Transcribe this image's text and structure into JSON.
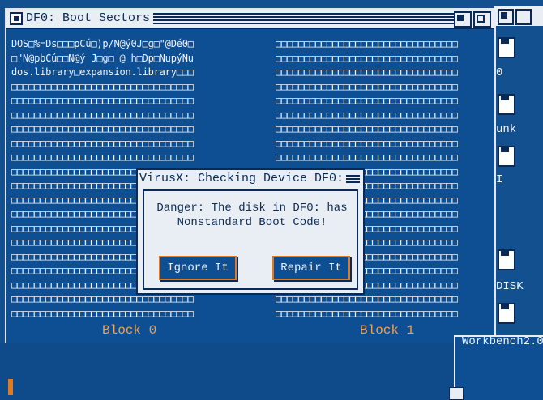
{
  "window": {
    "title": "DF0: Boot Sectors",
    "left_column_lines": [
      "DOS□%=Ds□□□pCú□)p/N@ý0J□g□\"@Dé0□",
      "□\"N@pbCú□□N@ý J□g□ @ h□Dp□NupýNu",
      "dos.library□expansion.library□□□",
      "□□□□□□□□□□□□□□□□□□□□□□□□□□□□□□□□",
      "□□□□□□□□□□□□□□□□□□□□□□□□□□□□□□□□",
      "□□□□□□□□□□□□□□□□□□□□□□□□□□□□□□□□",
      "□□□□□□□□□□□□□□□□□□□□□□□□□□□□□□□□",
      "□□□□□□□□□□□□□□□□□□□□□□□□□□□□□□□□",
      "□□□□□□□□□□□□□□□□□□□□□□□□□□□□□□□□",
      "□□□□□□□□□□□□□□□□□□□□□□□□□□□□□□□□",
      "□□□□□□□□□□□□□□□□□□□□□□□□□□□□□□□□",
      "□□□□□□□□□□□□□□□□□□□□□□□□□□□□□□□□",
      "□□□□□□□□□□□□□□□□□□□□□□□□□□□□□□□□",
      "□□□□□□□□□□□□□□□□□□□□□□□□□□□□□□□□",
      "□□□□□□□□□□□□□□□□□□□□□□□□□□□□□□□□",
      "□□□□□□□□□□□□□□□□□□□□□□□□□□□□□□□□",
      "□□□□□□□□□□□□□□□□□□□□□□□□□□□□□□□□",
      "□□□□□□□□□□□□□□□□□□□□□□□□□□□□□□□□",
      "□□□□□□□□□□□□□□□□□□□□□□□□□□□□□□□□",
      "□□□□□□□□□□□□□□□□□□□□□□□□□□□□□□□□"
    ],
    "right_column_lines": [
      "□□□□□□□□□□□□□□□□□□□□□□□□□□□□□□□□",
      "□□□□□□□□□□□□□□□□□□□□□□□□□□□□□□□□",
      "□□□□□□□□□□□□□□□□□□□□□□□□□□□□□□□□",
      "□□□□□□□□□□□□□□□□□□□□□□□□□□□□□□□□",
      "□□□□□□□□□□□□□□□□□□□□□□□□□□□□□□□□",
      "□□□□□□□□□□□□□□□□□□□□□□□□□□□□□□□□",
      "□□□□□□□□□□□□□□□□□□□□□□□□□□□□□□□□",
      "□□□□□□□□□□□□□□□□□□□□□□□□□□□□□□□□",
      "□□□□□□□□□□□□□□□□□□□□□□□□□□□□□□□□",
      "□□□□□□□□□□□□□□□□□□□□□□□□□□□□□□□□",
      "□□□□□□□□□□□□□□□□□□□□□□□□□□□□□□□□",
      "□□□□□□□□□□□□□□□□□□□□□□□□□□□□□□□□",
      "□□□□□□□□□□□□□□□□□□□□□□□□□□□□□□□□",
      "□□□□□□□□□□□□□□□□□□□□□□□□□□□□□□□□",
      "□□□□□□□□□□□□□□□□□□□□□□□□□□□□□□□□",
      "□□□□□□□□□□□□□□□□□□□□□□□□□□□□□□□□",
      "□□□□□□□□□□□□□□□□□□□□□□□□□□□□□□□□",
      "□□□□□□□□□□□□□□□□□□□□□□□□□□□□□□□□",
      "□□□□□□□□□□□□□□□□□□□□□□□□□□□□□□□□",
      "□□□□□□□□□□□□□□□□□□□□□□□□□□□□□□□□"
    ],
    "block_left_label": "Block 0",
    "block_right_label": "Block 1"
  },
  "requester": {
    "title": "VirusX: Checking Device DF0:",
    "message_line1": "Danger:  The disk in DF0: has",
    "message_line2": "Nonstandard Boot Code!",
    "ignore_label": "Ignore It",
    "repair_label": "Repair It"
  },
  "workbench": {
    "icons": [
      {
        "label": "0"
      },
      {
        "label": "unk"
      },
      {
        "label": "I"
      },
      {
        "label": "DISK"
      }
    ],
    "window_title": "Workbench2.0"
  },
  "colors": {
    "background": "#0e4f93",
    "accent": "#e07a20",
    "text": "#eef3fa",
    "chrome": "#e9eef5"
  }
}
